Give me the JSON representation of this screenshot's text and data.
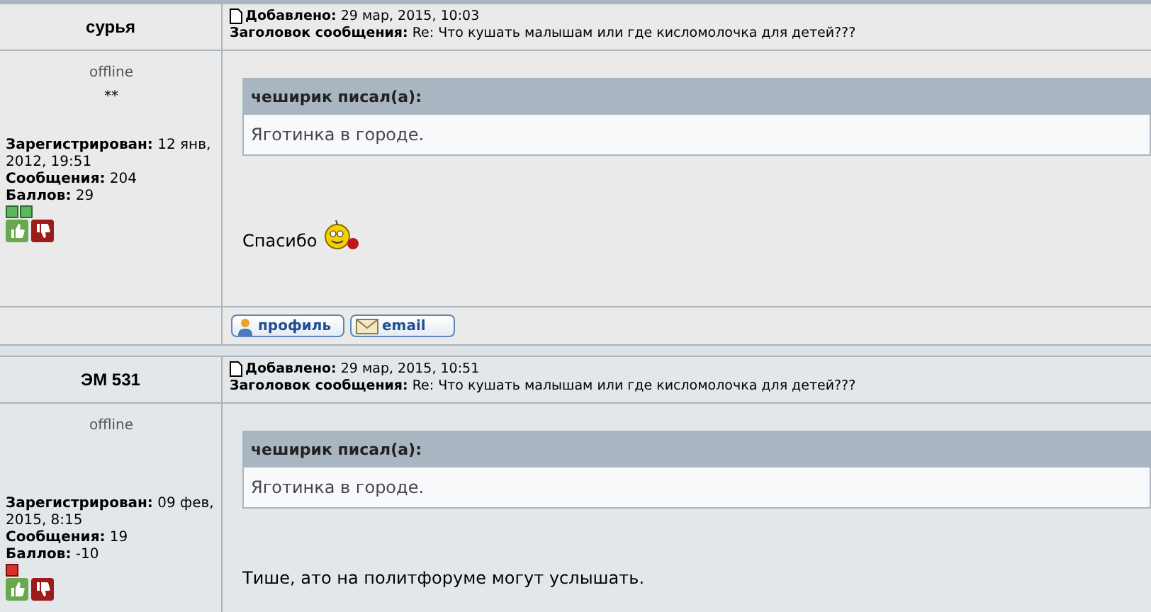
{
  "posts": [
    {
      "author": "сурья",
      "status": "offline",
      "rank": "**",
      "registered_label": "Зарегистрирован:",
      "registered": "12 янв, 2012, 19:51",
      "messages_label": "Сообщения:",
      "messages": "204",
      "points_label": "Баллов:",
      "points": "29",
      "reputation": [
        {
          "color": "#5cb85c"
        },
        {
          "color": "#5cb85c"
        }
      ],
      "added_label": "Добавлено:",
      "added": "29 мар, 2015, 10:03",
      "subject_label": "Заголовок сообщения:",
      "subject": "Re: Что кушать малышам или где кисломолочка для детей???",
      "quote_author": "чеширик писал(а):",
      "quote_text": "Яготинка в городе.",
      "body": [
        {
          "kind": "text",
          "text": "Спасибо"
        },
        {
          "kind": "smiley"
        }
      ],
      "buttons": [
        "профиль",
        "email"
      ]
    },
    {
      "author": "ЭМ 531",
      "status": "offline",
      "registered_label": "Зарегистрирован:",
      "registered": "09 фев, 2015, 8:15",
      "messages_label": "Сообщения:",
      "messages": "19",
      "points_label": "Баллов:",
      "points": "-10",
      "reputation": [
        {
          "color": "#d9302a"
        }
      ],
      "added_label": "Добавлено:",
      "added": "29 мар, 2015, 10:51",
      "subject_label": "Заголовок сообщения:",
      "subject": "Re: Что кушать малышам или где кисломолочка для детей???",
      "quote_author": "чеширик писал(а):",
      "quote_text": "Яготинка в городе.",
      "body": [
        {
          "kind": "text",
          "text": "Тише, ато на политфоруме могут услышать."
        }
      ]
    }
  ]
}
